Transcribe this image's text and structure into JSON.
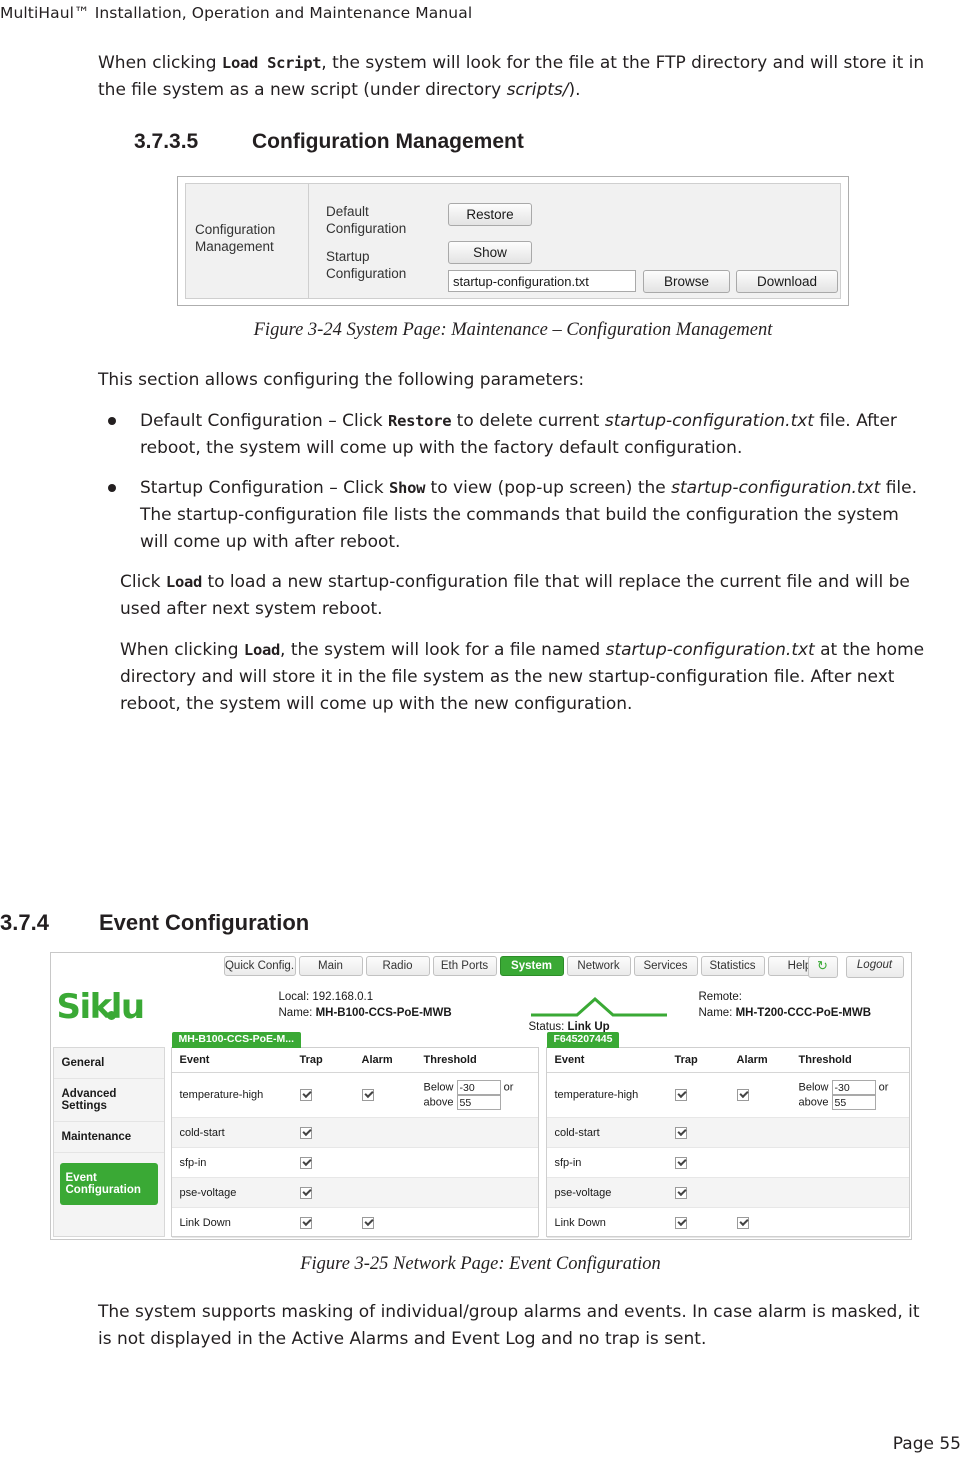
{
  "header": {
    "title": "MultiHaul™ Installation, Operation and Maintenance Manual"
  },
  "footer": {
    "page": "Page 55"
  },
  "intro": {
    "p1_a": "When clicking ",
    "p1_code": "Load Script",
    "p1_b": ", the system will look for the file at the FTP directory and will store it in the file system as a new script (under directory ",
    "p1_italic": "scripts/",
    "p1_c": ")."
  },
  "section_3735": {
    "number": "3.7.3.5",
    "title": "Configuration Management"
  },
  "figure24": {
    "caption": "Figure 3-24 System Page: Maintenance – Configuration Management",
    "panel_label_line1": "Configuration",
    "panel_label_line2": "Management",
    "default_label_line1": "Default",
    "default_label_line2": "Configuration",
    "startup_label_line1": "Startup",
    "startup_label_line2": "Configuration",
    "restore_button": "Restore",
    "show_button": "Show",
    "filename_value": "startup-configuration.txt",
    "browse_button": "Browse",
    "download_button": "Download"
  },
  "body": {
    "intro_line": "This section allows configuring the following parameters:",
    "bullet1": {
      "a": "Default Configuration – Click ",
      "code": "Restore",
      "b": " to delete current ",
      "italic": "startup-configuration.txt",
      "c": " file. After reboot, the system will come up with the factory default configuration."
    },
    "bullet2": {
      "a": "Startup Configuration – Click ",
      "code": "Show",
      "b": " to view (pop-up screen) the ",
      "italic": "startup-configuration.txt",
      "c": " file. The startup-configuration file lists the commands that build the configuration the system will come up with after reboot."
    },
    "para_click_load": {
      "a": "Click ",
      "code": "Load",
      "b": " to load a new startup-configuration file that will replace the current file and will be used after next system reboot."
    },
    "para_when_clicking": {
      "a": "When clicking ",
      "code": "Load",
      "b": ", the system will look for a file named ",
      "italic": "startup-configuration.txt",
      "c": " at the home directory and will store it in the file system as the new startup-configuration file. After next reboot, the system will come up with the new configuration."
    }
  },
  "section_374": {
    "number": "3.7.4",
    "title": "Event Configuration"
  },
  "figure25": {
    "caption": "Figure 3-25 Network Page: Event Configuration",
    "tabs": [
      "Quick Config.",
      "Main",
      "Radio",
      "Eth Ports",
      "System",
      "Network",
      "Services",
      "Statistics",
      "Help"
    ],
    "active_tab": "System",
    "refresh_icon": "refresh-icon",
    "logout_button": "Logout",
    "logo_text": "Siklu",
    "local": {
      "line1": "Local: 192.168.0.1",
      "line2_label": "Name: ",
      "line2_value": "MH-B100-CCS-PoE-MWB"
    },
    "remote": {
      "line1": "Remote:",
      "line2_label": "Name: ",
      "line2_value": "MH-T200-CCC-PoE-MWB"
    },
    "status_label": "Status: ",
    "status_value": "Link Up",
    "sidebar": [
      {
        "label": "General",
        "active": false
      },
      {
        "label": "Advanced Settings",
        "active": false
      },
      {
        "label": "Maintenance",
        "active": false
      },
      {
        "label": "Event Configuration",
        "active": true
      }
    ],
    "left_panel": {
      "tab_label": "MH-B100-CCS-PoE-M...",
      "columns": [
        "Event",
        "Trap",
        "Alarm",
        "Threshold"
      ],
      "rows": [
        {
          "event": "temperature-high",
          "trap": true,
          "alarm": true,
          "threshold_below_label": "Below",
          "threshold_below_value": "-30",
          "threshold_above_label": "or above",
          "threshold_above_value": "55"
        },
        {
          "event": "cold-start",
          "trap": true,
          "alarm": false,
          "threshold_below_label": "",
          "threshold_below_value": "",
          "threshold_above_label": "",
          "threshold_above_value": ""
        },
        {
          "event": "sfp-in",
          "trap": true,
          "alarm": false,
          "threshold_below_label": "",
          "threshold_below_value": "",
          "threshold_above_label": "",
          "threshold_above_value": ""
        },
        {
          "event": "pse-voltage",
          "trap": true,
          "alarm": false,
          "threshold_below_label": "",
          "threshold_below_value": "",
          "threshold_above_label": "",
          "threshold_above_value": ""
        },
        {
          "event": "Link Down",
          "trap": true,
          "alarm": true,
          "threshold_below_label": "",
          "threshold_below_value": "",
          "threshold_above_label": "",
          "threshold_above_value": ""
        }
      ]
    },
    "right_panel": {
      "tab_label": "F645207445",
      "columns": [
        "Event",
        "Trap",
        "Alarm",
        "Threshold"
      ],
      "rows": [
        {
          "event": "temperature-high",
          "trap": true,
          "alarm": true,
          "threshold_below_label": "Below",
          "threshold_below_value": "-30",
          "threshold_above_label": "or above",
          "threshold_above_value": "55"
        },
        {
          "event": "cold-start",
          "trap": true,
          "alarm": false,
          "threshold_below_label": "",
          "threshold_below_value": "",
          "threshold_above_label": "",
          "threshold_above_value": ""
        },
        {
          "event": "sfp-in",
          "trap": true,
          "alarm": false,
          "threshold_below_label": "",
          "threshold_below_value": "",
          "threshold_above_label": "",
          "threshold_above_value": ""
        },
        {
          "event": "pse-voltage",
          "trap": true,
          "alarm": false,
          "threshold_below_label": "",
          "threshold_below_value": "",
          "threshold_above_label": "",
          "threshold_above_value": ""
        },
        {
          "event": "Link Down",
          "trap": true,
          "alarm": true,
          "threshold_below_label": "",
          "threshold_below_value": "",
          "threshold_above_label": "",
          "threshold_above_value": ""
        }
      ]
    }
  },
  "closing": {
    "text": "The system supports masking of individual/group alarms and events. In case alarm is masked, it is not displayed in the Active Alarms and Event Log and no trap is sent."
  },
  "colors": {
    "accent_green": "#3aa935",
    "text": "#231f20"
  }
}
